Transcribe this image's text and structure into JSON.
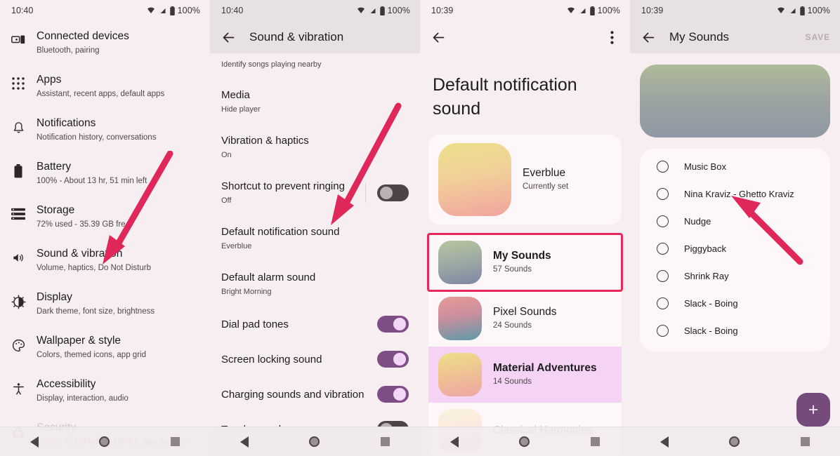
{
  "panels": [
    {
      "id": "settings-main",
      "statusbar": {
        "time": "10:40",
        "battery": "100%"
      },
      "rows": [
        {
          "icon": "connected-devices-icon",
          "title": "Connected devices",
          "subtitle": "Bluetooth, pairing"
        },
        {
          "icon": "apps-grid-icon",
          "title": "Apps",
          "subtitle": "Assistant, recent apps, default apps"
        },
        {
          "icon": "bell-icon",
          "title": "Notifications",
          "subtitle": "Notification history, conversations"
        },
        {
          "icon": "battery-icon",
          "title": "Battery",
          "subtitle": "100% - About 13 hr, 51 min left"
        },
        {
          "icon": "storage-icon",
          "title": "Storage",
          "subtitle": "72% used - 35.39 GB fre"
        },
        {
          "icon": "volume-icon",
          "title": "Sound & vibration",
          "subtitle": "Volume, haptics, Do Not Disturb"
        },
        {
          "icon": "brightness-icon",
          "title": "Display",
          "subtitle": "Dark theme, font size, brightness"
        },
        {
          "icon": "palette-icon",
          "title": "Wallpaper & style",
          "subtitle": "Colors, themed icons, app grid"
        },
        {
          "icon": "accessibility-icon",
          "title": "Accessibility",
          "subtitle": "Display, interaction, audio"
        },
        {
          "icon": "lock-icon",
          "title": "Security",
          "subtitle": "Screen lock, Find My Device, app security"
        }
      ]
    },
    {
      "id": "sound-vibration",
      "statusbar": {
        "time": "10:40",
        "battery": "100%"
      },
      "appbar": {
        "title": "Sound & vibration",
        "back": "back-arrow-icon"
      },
      "partial_row_subtitle": "Identify songs playing nearby",
      "rows": [
        {
          "title": "Media",
          "subtitle": "Hide player",
          "control": "none"
        },
        {
          "title": "Vibration & haptics",
          "subtitle": "On",
          "control": "none"
        },
        {
          "title": "Shortcut to prevent ringing",
          "subtitle": "Off",
          "control": "switch",
          "state": "off"
        },
        {
          "title": "Default notification sound",
          "subtitle": "Everblue",
          "control": "none"
        },
        {
          "title": "Default alarm sound",
          "subtitle": "Bright Morning",
          "control": "none"
        },
        {
          "title": "Dial pad tones",
          "subtitle": "",
          "control": "switch",
          "state": "on"
        },
        {
          "title": "Screen locking sound",
          "subtitle": "",
          "control": "switch",
          "state": "on"
        },
        {
          "title": "Charging sounds and vibration",
          "subtitle": "",
          "control": "switch",
          "state": "on"
        },
        {
          "title": "Touch sounds",
          "subtitle": "",
          "control": "switch",
          "state": "off"
        }
      ]
    },
    {
      "id": "default-notification-sound",
      "statusbar": {
        "time": "10:39",
        "battery": "100%"
      },
      "appbar": {
        "back": "back-arrow-icon",
        "overflow": "more-vertical-icon"
      },
      "title": "Default notification sound",
      "current": {
        "name": "Everblue",
        "status": "Currently set",
        "thumb": "everblue"
      },
      "items": [
        {
          "name": "My Sounds",
          "count": "57 Sounds",
          "thumb": "mysounds",
          "highlighted": true
        },
        {
          "name": "Pixel Sounds",
          "count": "24 Sounds",
          "thumb": "pixel",
          "highlighted": false
        },
        {
          "name": "Material Adventures",
          "count": "14 Sounds",
          "thumb": "material",
          "selected": true
        },
        {
          "name": "Classical Harmonies",
          "count": "",
          "thumb": "material",
          "faded": true
        }
      ]
    },
    {
      "id": "my-sounds",
      "statusbar": {
        "time": "10:39",
        "battery": "100%"
      },
      "appbar": {
        "title": "My Sounds",
        "back": "back-arrow-icon",
        "action": "SAVE"
      },
      "sounds": [
        {
          "label": "Music Box",
          "selected": false
        },
        {
          "label": "Nina Kraviz - Ghetto Kraviz",
          "selected": false
        },
        {
          "label": "Nudge",
          "selected": false
        },
        {
          "label": "Piggyback",
          "selected": false
        },
        {
          "label": "Shrink Ray",
          "selected": false
        },
        {
          "label": "Slack - Boing",
          "selected": false
        },
        {
          "label": "Slack - Boing",
          "selected": false
        }
      ],
      "fab": {
        "icon": "plus-icon",
        "label": "+"
      }
    }
  ],
  "navbar": {
    "back": "nav-back-icon",
    "home": "nav-home-icon",
    "recents": "nav-recents-icon"
  },
  "annotation": {
    "color": "#e0275a",
    "arrow_count": 3
  }
}
